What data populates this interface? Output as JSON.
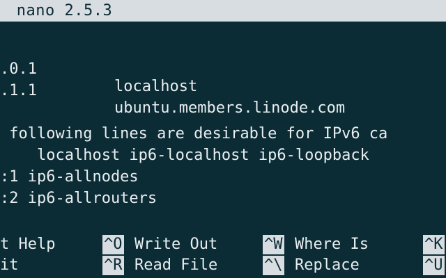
{
  "window": {
    "title": " nano 2.5.3"
  },
  "editor": {
    "lines": [
      {
        "left": ".0.1",
        "right": "localhost"
      },
      {
        "left": ".1.1",
        "right": "ubuntu.members.linode.com"
      },
      {
        "text": " following lines are desirable for IPv6 ca"
      },
      {
        "text": "    localhost ip6-localhost ip6-loopback"
      },
      {
        "text": ":1 ip6-allnodes"
      },
      {
        "text": ":2 ip6-allrouters"
      }
    ]
  },
  "shortcuts": {
    "row1": [
      {
        "key": "",
        "label": "t Help"
      },
      {
        "key": "^O",
        "label": "Write Out"
      },
      {
        "key": "^W",
        "label": "Where Is"
      },
      {
        "key": "^K",
        "label": ""
      }
    ],
    "row2": [
      {
        "key": "",
        "label": "it"
      },
      {
        "key": "^R",
        "label": "Read File"
      },
      {
        "key": "^\\",
        "label": "Replace"
      },
      {
        "key": "^U",
        "label": ""
      }
    ]
  }
}
